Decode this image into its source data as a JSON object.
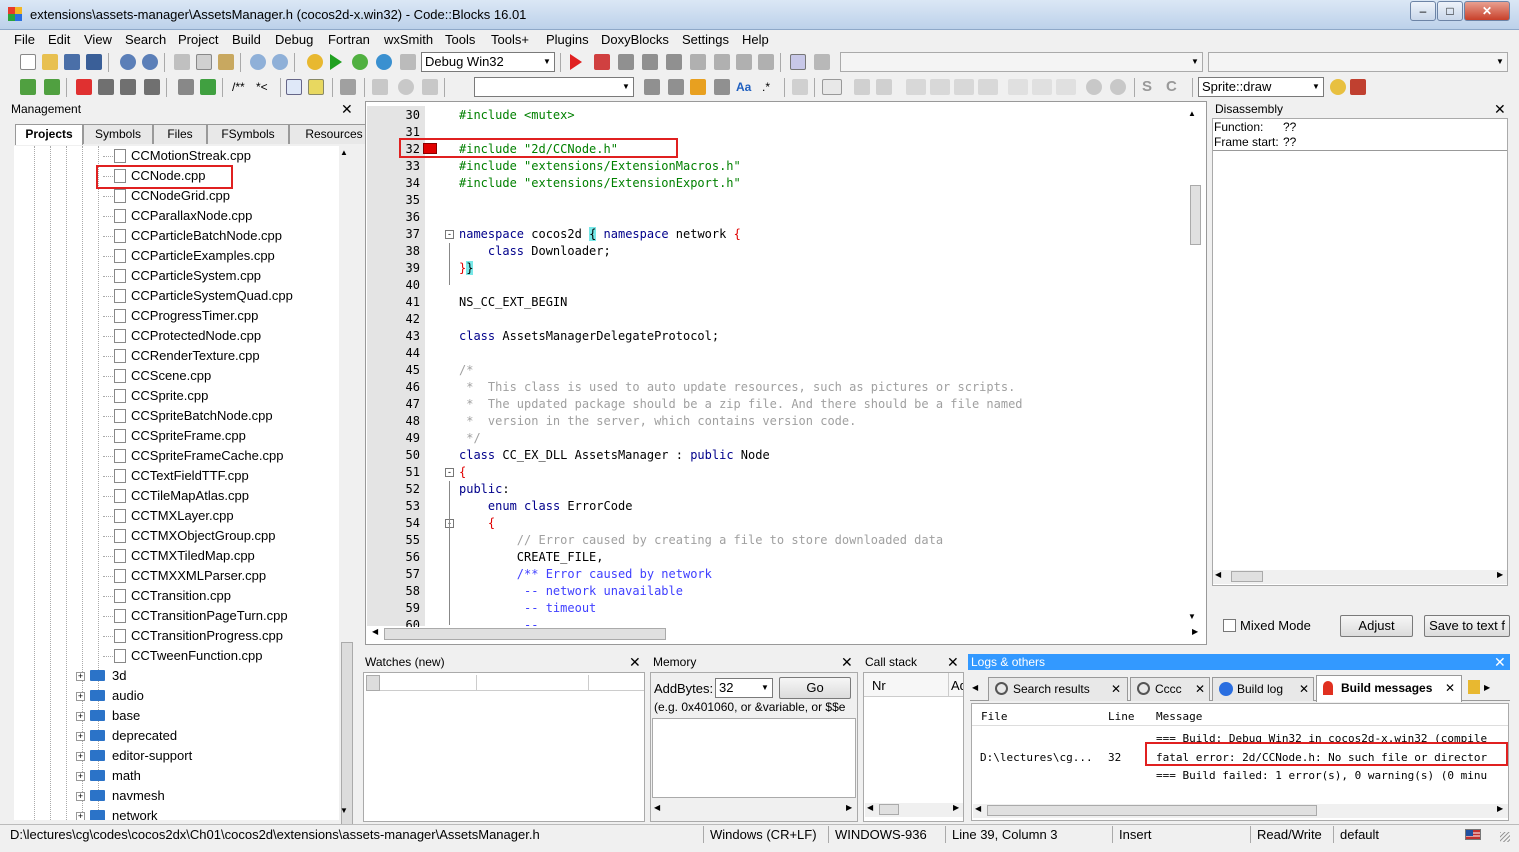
{
  "window": {
    "title": "extensions\\assets-manager\\AssetsManager.h (cocos2d-x.win32) - Code::Blocks 16.01"
  },
  "menu": [
    "File",
    "Edit",
    "View",
    "Search",
    "Project",
    "Build",
    "Debug",
    "Fortran",
    "wxSmith",
    "Tools",
    "Tools+",
    "Plugins",
    "DoxyBlocks",
    "Settings",
    "Help"
  ],
  "toolbar": {
    "build_target": "Debug Win32",
    "symbol": "Sprite::draw"
  },
  "management": {
    "title": "Management",
    "tabs": [
      "Projects",
      "Symbols",
      "Files",
      "FSymbols",
      "Resources"
    ],
    "files": [
      "CCMotionStreak.cpp",
      "CCNode.cpp",
      "CCNodeGrid.cpp",
      "CCParallaxNode.cpp",
      "CCParticleBatchNode.cpp",
      "CCParticleExamples.cpp",
      "CCParticleSystem.cpp",
      "CCParticleSystemQuad.cpp",
      "CCProgressTimer.cpp",
      "CCProtectedNode.cpp",
      "CCRenderTexture.cpp",
      "CCScene.cpp",
      "CCSprite.cpp",
      "CCSpriteBatchNode.cpp",
      "CCSpriteFrame.cpp",
      "CCSpriteFrameCache.cpp",
      "CCTextFieldTTF.cpp",
      "CCTileMapAtlas.cpp",
      "CCTMXLayer.cpp",
      "CCTMXObjectGroup.cpp",
      "CCTMXTiledMap.cpp",
      "CCTMXXMLParser.cpp",
      "CCTransition.cpp",
      "CCTransitionPageTurn.cpp",
      "CCTransitionProgress.cpp",
      "CCTweenFunction.cpp"
    ],
    "folders": [
      "3d",
      "audio",
      "base",
      "deprecated",
      "editor-support",
      "math",
      "navmesh",
      "network"
    ]
  },
  "editor": {
    "lines": [
      {
        "n": "30",
        "t": "#include <mutex>"
      },
      {
        "n": "31",
        "t": ""
      },
      {
        "n": "32",
        "t": "#include \"2d/CCNode.h\""
      },
      {
        "n": "33",
        "t": "#include \"extensions/ExtensionMacros.h\""
      },
      {
        "n": "34",
        "t": "#include \"extensions/ExtensionExport.h\""
      },
      {
        "n": "35",
        "t": ""
      },
      {
        "n": "36",
        "t": ""
      },
      {
        "n": "37",
        "t": "namespace cocos2d { namespace network {"
      },
      {
        "n": "38",
        "t": "    class Downloader;"
      },
      {
        "n": "39",
        "t": "}}"
      },
      {
        "n": "40",
        "t": ""
      },
      {
        "n": "41",
        "t": "NS_CC_EXT_BEGIN"
      },
      {
        "n": "42",
        "t": ""
      },
      {
        "n": "43",
        "t": "class AssetsManagerDelegateProtocol;"
      },
      {
        "n": "44",
        "t": ""
      },
      {
        "n": "45",
        "t": "/*"
      },
      {
        "n": "46",
        "t": " *  This class is used to auto update resources, such as pictures or scripts."
      },
      {
        "n": "47",
        "t": " *  The updated package should be a zip file. And there should be a file named"
      },
      {
        "n": "48",
        "t": " *  version in the server, which contains version code."
      },
      {
        "n": "49",
        "t": " */"
      },
      {
        "n": "50",
        "t": "class CC_EX_DLL AssetsManager : public Node"
      },
      {
        "n": "51",
        "t": "{"
      },
      {
        "n": "52",
        "t": "public:"
      },
      {
        "n": "53",
        "t": "    enum class ErrorCode"
      },
      {
        "n": "54",
        "t": "    {"
      },
      {
        "n": "55",
        "t": "        // Error caused by creating a file to store downloaded data"
      },
      {
        "n": "56",
        "t": "        CREATE_FILE,"
      },
      {
        "n": "57",
        "t": "        /** Error caused by network"
      },
      {
        "n": "58",
        "t": "         -- network unavailable"
      },
      {
        "n": "59",
        "t": "         -- timeout"
      },
      {
        "n": "60",
        "t": "         --"
      }
    ]
  },
  "disassembly": {
    "title": "Disassembly",
    "function_label": "Function:",
    "function_value": "??",
    "frame_label": "Frame start:",
    "frame_value": "??",
    "mixed_mode": "Mixed Mode",
    "adjust": "Adjust",
    "save": "Save to text f"
  },
  "watches": {
    "title": "Watches (new)"
  },
  "memory": {
    "title": "Memory",
    "addr_label": "Address:",
    "bytes_label": "Bytes:",
    "bytes_value": "32",
    "go": "Go",
    "hint": "(e.g. 0x401060, or &variable, or $$e"
  },
  "callstack": {
    "title": "Call stack",
    "col_nr": "Nr",
    "col_ad": "Ad"
  },
  "logs": {
    "title": "Logs & others",
    "tabs": [
      "Search results",
      "Cccc",
      "Build log",
      "Build messages"
    ],
    "columns": [
      "File",
      "Line",
      "Message"
    ],
    "rows": [
      {
        "file": "",
        "line": "",
        "msg": "=== Build: Debug Win32 in cocos2d-x.win32 (compile"
      },
      {
        "file": "D:\\lectures\\cg...",
        "line": "32",
        "msg": "fatal error: 2d/CCNode.h: No such file or director"
      },
      {
        "file": "",
        "line": "",
        "msg": "=== Build failed: 1 error(s), 0 warning(s) (0 minu"
      }
    ]
  },
  "status": {
    "path": "D:\\lectures\\cg\\codes\\cocos2dx\\Ch01\\cocos2d\\extensions\\assets-manager\\AssetsManager.h",
    "eol": "Windows (CR+LF)",
    "encoding": "WINDOWS-936",
    "position": "Line 39, Column 3",
    "mode": "Insert",
    "access": "Read/Write",
    "profile": "default"
  },
  "colors": {
    "accent": "#3399ff",
    "highlight_box": "#e02020",
    "preproc": "#008000",
    "keyword": "#00008b",
    "comment": "#a0a0a0"
  }
}
